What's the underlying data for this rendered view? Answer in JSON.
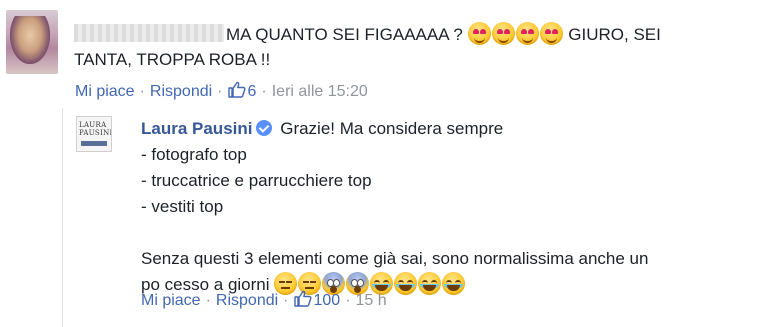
{
  "comment1": {
    "text_line1": "MA QUANTO SEI FIGAAAAA ?",
    "emojis_a": [
      "heart-eyes",
      "heart-eyes",
      "heart-eyes",
      "heart-eyes"
    ],
    "text_line1_end": "GIURO, SEI",
    "text_line2": "TANTA, TROPPA ROBA !!",
    "actions": {
      "like": "Mi piace",
      "reply": "Rispondi",
      "like_count": "6",
      "timestamp": "Ieri alle 15:20"
    }
  },
  "comment2": {
    "author": "Laura Pausini",
    "avatar_text": "LAURA PAUSINI",
    "lines": [
      "Grazie! Ma considera sempre",
      "- fotografo top",
      "- truccatrice e parrucchiere top",
      "- vestiti top"
    ],
    "paragraph_line1": "Senza questi 3 elementi come già sai, sono normalissima anche un",
    "paragraph_line2": "po cesso a giorni",
    "emojis_b": [
      "neutral-face",
      "neutral-face",
      "scream-face",
      "scream-face",
      "joy-face",
      "joy-face",
      "joy-face",
      "joy-face"
    ],
    "actions": {
      "like": "Mi piace",
      "reply": "Rispondi",
      "like_count": "100",
      "timestamp": "15 h"
    }
  },
  "colors": {
    "link": "#4267b2",
    "author": "#365899",
    "meta": "#90949c",
    "text": "#1d2129"
  }
}
